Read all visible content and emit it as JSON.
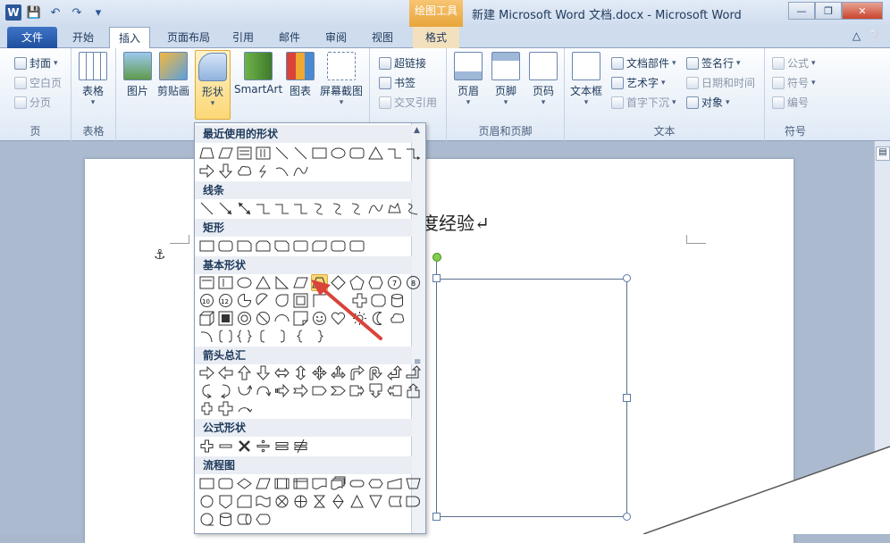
{
  "window": {
    "title": "新建 Microsoft Word 文档.docx - Microsoft Word",
    "context_tab_group": "绘图工具",
    "app_logo": "W",
    "qat_icons": [
      "save-icon",
      "undo-icon",
      "redo-icon",
      "customize-icon"
    ]
  },
  "tabs": {
    "file": "文件",
    "home": "开始",
    "insert": "插入",
    "layout": "页面布局",
    "references": "引用",
    "mailings": "邮件",
    "review": "审阅",
    "view": "视图",
    "format": "格式"
  },
  "ribbon": {
    "groups": {
      "pages": "页",
      "tables": "表格",
      "header_footer": "页眉和页脚",
      "text": "文本",
      "symbols": "符号"
    },
    "buttons": {
      "cover": "封面",
      "blank_page": "空白页",
      "page_break": "分页",
      "table": "表格",
      "picture": "图片",
      "clipart": "剪贴画",
      "shapes": "形状",
      "smartart": "SmartArt",
      "chart": "图表",
      "screenshot": "屏幕截图",
      "hyperlink": "超链接",
      "bookmark": "书签",
      "cross_ref": "交叉引用",
      "header": "页眉",
      "footer": "页脚",
      "page_number": "页码",
      "textbox": "文本框",
      "quick_parts": "文档部件",
      "wordart": "艺术字",
      "dropcap": "首字下沉",
      "signature": "签名行",
      "datetime": "日期和时间",
      "object": "对象",
      "equation": "公式",
      "symbol": "符号",
      "numbering": "编号"
    }
  },
  "document": {
    "visible_text": "度经验↵"
  },
  "gallery": {
    "sections": {
      "recent": "最近使用的形状",
      "lines": "线条",
      "rectangles": "矩形",
      "basic": "基本形状",
      "arrows": "箭头总汇",
      "equation": "公式形状",
      "flowchart": "流程图"
    }
  },
  "colors": {
    "accent": "#2b579a",
    "context_tab": "#e8a53a",
    "selected": "#fbd776",
    "annotation_arrow": "#d9433a"
  }
}
